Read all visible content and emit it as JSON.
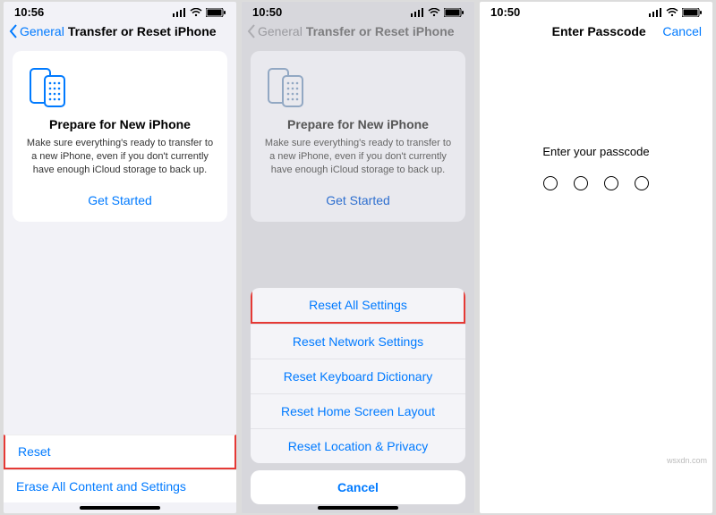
{
  "screens": [
    {
      "status_time": "10:56",
      "back_label": "General",
      "title": "Transfer or Reset iPhone",
      "card_title": "Prepare for New iPhone",
      "card_body": "Make sure everything's ready to transfer to a new iPhone, even if you don't currently have enough iCloud storage to back up.",
      "card_cta": "Get Started",
      "rows": [
        "Reset",
        "Erase All Content and Settings"
      ]
    },
    {
      "status_time": "10:50",
      "back_label": "General",
      "title": "Transfer or Reset iPhone",
      "card_title": "Prepare for New iPhone",
      "card_body": "Make sure everything's ready to transfer to a new iPhone, even if you don't currently have enough iCloud storage to back up.",
      "card_cta": "Get Started",
      "sheet": [
        "Reset All Settings",
        "Reset Network Settings",
        "Reset Keyboard Dictionary",
        "Reset Home Screen Layout",
        "Reset Location & Privacy"
      ],
      "sheet_cancel": "Cancel"
    },
    {
      "status_time": "10:50",
      "title": "Enter Passcode",
      "cancel": "Cancel",
      "hint": "Enter your passcode"
    }
  ],
  "watermark": "wsxdn.com"
}
